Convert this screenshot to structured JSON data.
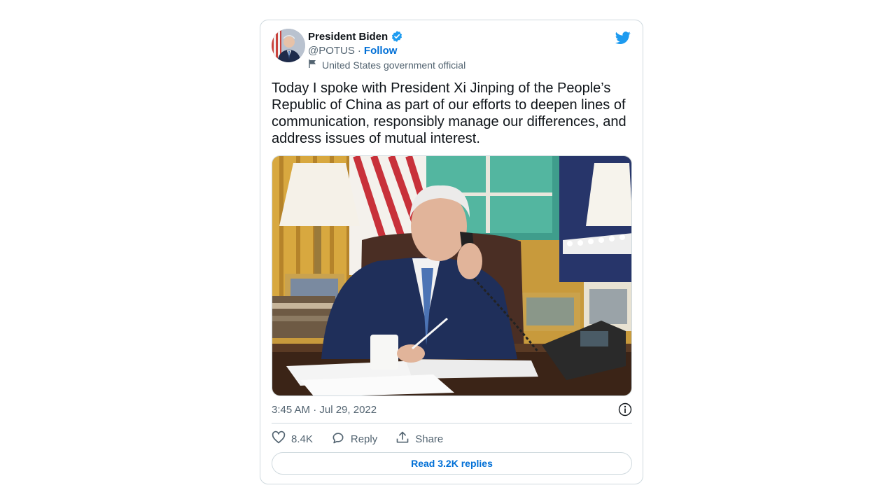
{
  "tweet": {
    "author_name": "President Biden",
    "handle": "@POTUS",
    "separator": "·",
    "follow_label": "Follow",
    "account_label": "United States government official",
    "text": "Today I spoke with President Xi Jinping of the People’s\nRepublic of China as part of our efforts to deepen lines of\ncommunication, responsibly manage our differences, and\naddress issues of mutual interest.",
    "timestamp": "3:45 AM · Jul 29, 2022",
    "likes": "8.4K",
    "reply_label": "Reply",
    "share_label": "Share",
    "read_replies_label": "Read 3.2K replies"
  },
  "icons": {
    "verified": "verified-badge-icon",
    "brand": "twitter-bird-icon",
    "label": "flag-icon",
    "info": "info-icon",
    "like": "heart-icon",
    "reply": "speech-bubble-icon",
    "share": "share-upload-icon"
  },
  "colors": {
    "accent": "#1d9bf0",
    "link": "#006fd6",
    "muted": "#536471",
    "border": "#cfd9de"
  }
}
